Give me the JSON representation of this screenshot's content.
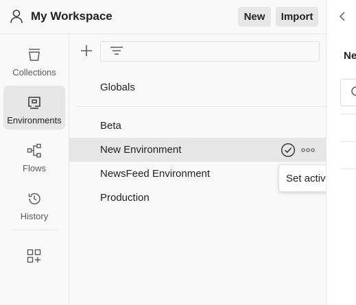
{
  "header": {
    "title": "My Workspace",
    "new_label": "New",
    "import_label": "Import"
  },
  "sidebar": {
    "items": [
      {
        "label": "Collections",
        "icon": "collections-icon",
        "active": false
      },
      {
        "label": "Environments",
        "icon": "environments-icon",
        "active": true
      },
      {
        "label": "Flows",
        "icon": "flows-icon",
        "active": false
      },
      {
        "label": "History",
        "icon": "history-icon",
        "active": false
      }
    ]
  },
  "environments": {
    "globals": "Globals",
    "items": [
      {
        "name": "Beta"
      },
      {
        "name": "New Environment"
      },
      {
        "name": "NewsFeed Environment"
      },
      {
        "name": "Production"
      }
    ]
  },
  "tooltip": {
    "text": "Set active"
  },
  "right_panel": {
    "title_fragment": "Ne"
  },
  "colors": {
    "background": "#f9f9f9",
    "active_bg": "#e6e6e6",
    "text": "#212121",
    "muted_text": "#5a5a5a"
  }
}
